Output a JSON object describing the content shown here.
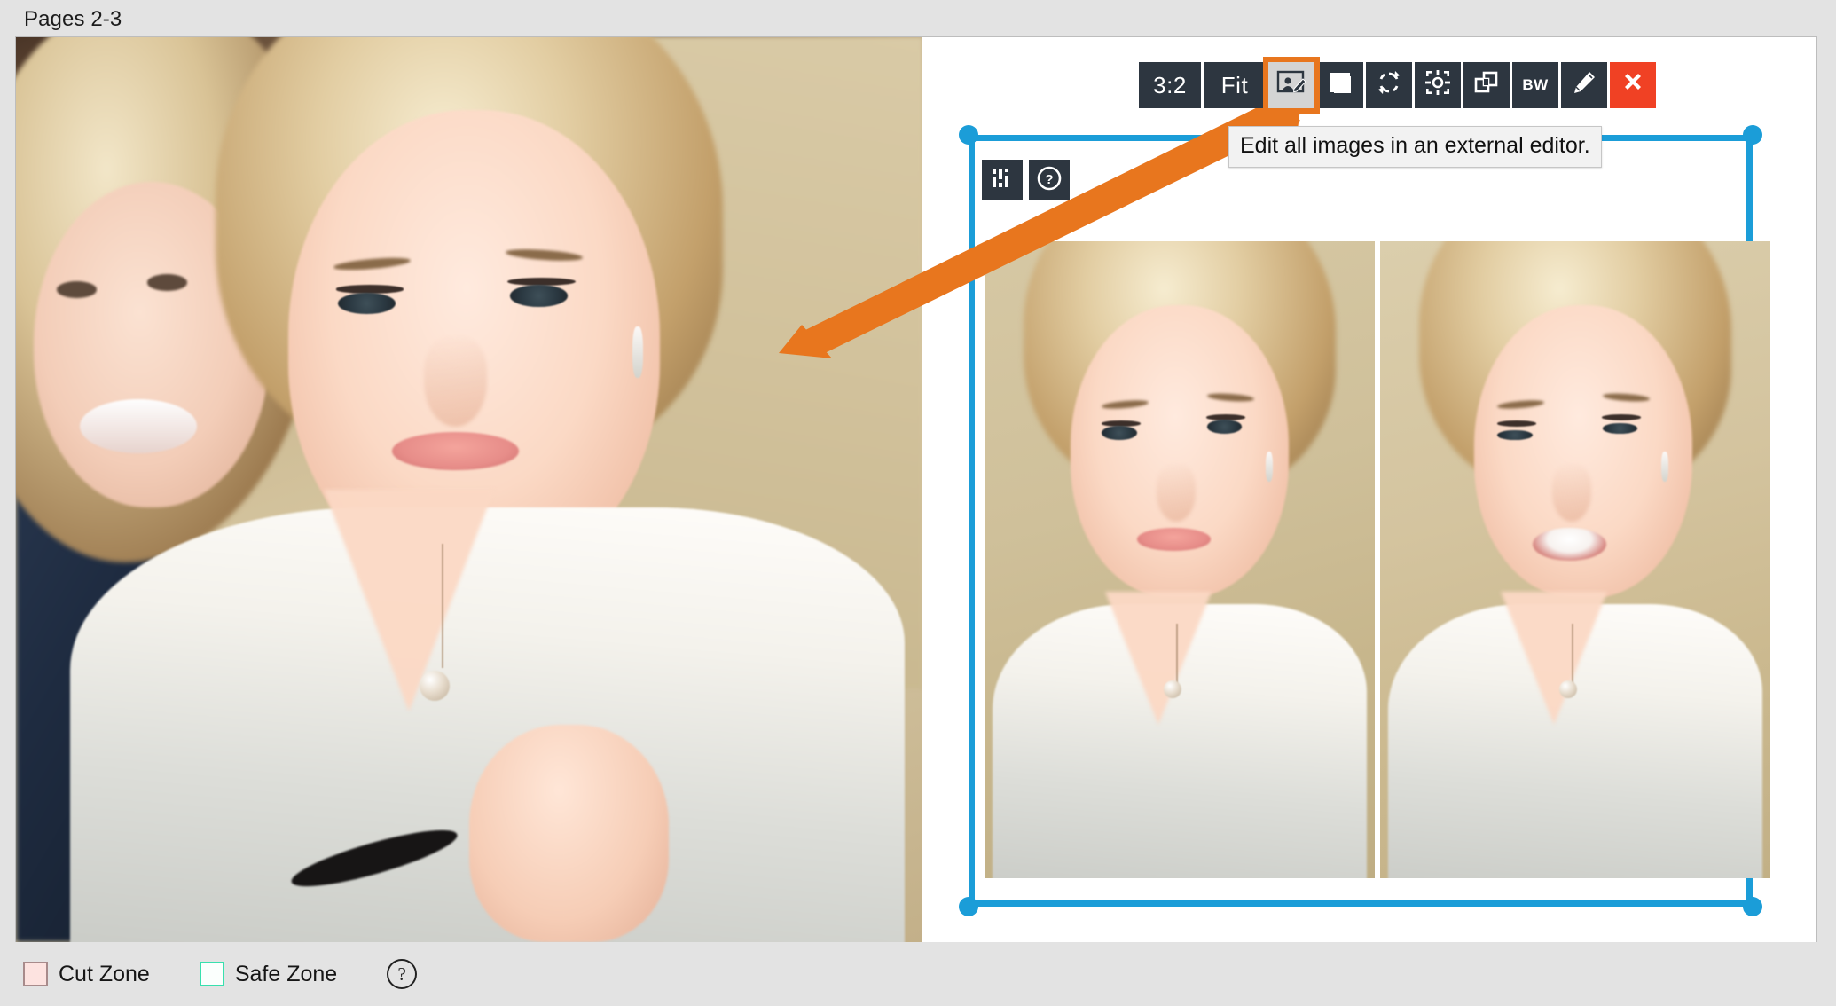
{
  "header": {
    "pages_label": "Pages 2-3"
  },
  "toolbar": {
    "buttons": [
      {
        "label": "3:2",
        "name": "aspect-ratio-3-2-button",
        "icon": "text",
        "highlight": false
      },
      {
        "label": "Fit",
        "name": "fit-button",
        "icon": "text",
        "highlight": false
      },
      {
        "label": "",
        "name": "edit-all-images-external-button",
        "icon": "image-edit-icon",
        "highlight": true
      },
      {
        "label": "",
        "name": "crop-fill-button",
        "icon": "square-fill-icon",
        "highlight": false
      },
      {
        "label": "",
        "name": "rotate-refresh-button",
        "icon": "refresh-icon",
        "highlight": false
      },
      {
        "label": "",
        "name": "auto-enhance-button",
        "icon": "focus-target-icon",
        "highlight": false
      },
      {
        "label": "",
        "name": "duplicate-button",
        "icon": "duplicate-icon",
        "highlight": false
      },
      {
        "label": "BW",
        "name": "black-and-white-button",
        "icon": "text",
        "highlight": false
      },
      {
        "label": "",
        "name": "edit-pencil-button",
        "icon": "pencil-icon",
        "highlight": false
      },
      {
        "label": "",
        "name": "delete-button",
        "icon": "close-x-icon",
        "highlight": false,
        "danger": true
      }
    ]
  },
  "tooltip": {
    "text": "Edit all images in an external editor."
  },
  "frame": {
    "icons": [
      {
        "name": "image-adjust-sliders-button",
        "icon": "sliders-icon"
      },
      {
        "name": "frame-help-button",
        "icon": "question-mark-icon"
      }
    ],
    "thumbnails": [
      {
        "name": "thumbnail-image-1",
        "alt": "Portrait of blonde woman looking to the side"
      },
      {
        "name": "thumbnail-image-2",
        "alt": "Portrait of blonde woman smiling"
      }
    ]
  },
  "spread": {
    "left_page": {
      "name": "page-left",
      "alt": "Two women, bride portrait in white robe"
    },
    "right_page": {
      "name": "page-right",
      "alt": "Blank white page with selected image frame"
    }
  },
  "legend": {
    "items": [
      {
        "label": "Cut Zone",
        "swatch_fill": "#fde3e0",
        "swatch_border": "#a88b8b"
      },
      {
        "label": "Safe Zone",
        "swatch_fill": "#fbfffd",
        "swatch_border": "#38e0ae"
      }
    ],
    "help": "?"
  },
  "colors": {
    "selection_blue": "#1b9dd8",
    "annotation_orange": "#e8761e",
    "toolbar_dark": "#2d3640",
    "danger_red": "#f04124",
    "app_background": "#e3e3e3"
  },
  "annotation": {
    "type": "arrow",
    "from": "toolbar edit-all-images-external-button",
    "to": "left page portrait"
  }
}
